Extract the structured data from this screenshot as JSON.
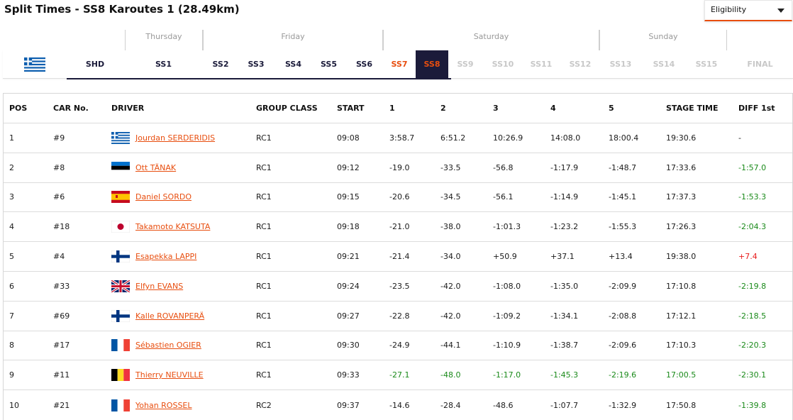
{
  "page": {
    "title": "Split Times - SS8 Karoutes 1 (28.49km)"
  },
  "eligibility": {
    "label": "Eligibility"
  },
  "days": [
    "Thursday",
    "Friday",
    "Saturday",
    "Sunday"
  ],
  "stages": [
    {
      "label": "SHD",
      "state": "done"
    },
    {
      "label": "SS1",
      "state": "done"
    },
    {
      "label": "SS2",
      "state": "done"
    },
    {
      "label": "SS3",
      "state": "done"
    },
    {
      "label": "SS4",
      "state": "done"
    },
    {
      "label": "SS5",
      "state": "done"
    },
    {
      "label": "SS6",
      "state": "done"
    },
    {
      "label": "SS7",
      "state": "live"
    },
    {
      "label": "SS8",
      "state": "active"
    },
    {
      "label": "SS9",
      "state": "future"
    },
    {
      "label": "SS10",
      "state": "future"
    },
    {
      "label": "SS11",
      "state": "future"
    },
    {
      "label": "SS12",
      "state": "future"
    },
    {
      "label": "SS13",
      "state": "future"
    },
    {
      "label": "SS14",
      "state": "future"
    },
    {
      "label": "SS15",
      "state": "future"
    },
    {
      "label": "FINAL",
      "state": "future"
    }
  ],
  "country_flag": "greece-flag",
  "columns": [
    "POS",
    "CAR No.",
    "DRIVER",
    "GROUP CLASS",
    "START",
    "1",
    "2",
    "3",
    "4",
    "5",
    "STAGE TIME",
    "DIFF 1st"
  ],
  "colors": {
    "accent": "#e84e0f",
    "navy": "#1b1b3a",
    "gain": "#1a8a1a",
    "loss": "#e81b1b"
  },
  "rows": [
    {
      "pos": "1",
      "car": "#9",
      "flag": "GR",
      "driver": "Jourdan SERDERIDIS",
      "class": "RC1",
      "start": "09:08",
      "s1": "3:58.7",
      "s2": "6:51.2",
      "s3": "10:26.9",
      "s4": "14:08.0",
      "s5": "18:00.4",
      "stage": "19:30.6",
      "diff": "-",
      "green": []
    },
    {
      "pos": "2",
      "car": "#8",
      "flag": "EE",
      "driver": "Ott TÄNAK",
      "class": "RC1",
      "start": "09:12",
      "s1": "-19.0",
      "s2": "-33.5",
      "s3": "-56.8",
      "s4": "-1:17.9",
      "s5": "-1:48.7",
      "stage": "17:33.6",
      "diff": "-1:57.0",
      "green": [
        "diff"
      ]
    },
    {
      "pos": "3",
      "car": "#6",
      "flag": "ES",
      "driver": "Daniel SORDO",
      "class": "RC1",
      "start": "09:15",
      "s1": "-20.6",
      "s2": "-34.5",
      "s3": "-56.1",
      "s4": "-1:14.9",
      "s5": "-1:45.1",
      "stage": "17:37.3",
      "diff": "-1:53.3",
      "green": [
        "diff"
      ]
    },
    {
      "pos": "4",
      "car": "#18",
      "flag": "JP",
      "driver": "Takamoto KATSUTA",
      "class": "RC1",
      "start": "09:18",
      "s1": "-21.0",
      "s2": "-38.0",
      "s3": "-1:01.3",
      "s4": "-1:23.2",
      "s5": "-1:55.3",
      "stage": "17:26.3",
      "diff": "-2:04.3",
      "green": [
        "diff"
      ]
    },
    {
      "pos": "5",
      "car": "#4",
      "flag": "FI",
      "driver": "Esapekka LAPPI",
      "class": "RC1",
      "start": "09:21",
      "s1": "-21.4",
      "s2": "-34.0",
      "s3": "+50.9",
      "s4": "+37.1",
      "s5": "+13.4",
      "stage": "19:38.0",
      "diff": "+7.4",
      "green": [],
      "red": [
        "diff"
      ]
    },
    {
      "pos": "6",
      "car": "#33",
      "flag": "GB",
      "driver": "Elfyn EVANS",
      "class": "RC1",
      "start": "09:24",
      "s1": "-23.5",
      "s2": "-42.0",
      "s3": "-1:08.0",
      "s4": "-1:35.0",
      "s5": "-2:09.9",
      "stage": "17:10.8",
      "diff": "-2:19.8",
      "green": [
        "diff"
      ]
    },
    {
      "pos": "7",
      "car": "#69",
      "flag": "FI",
      "driver": "Kalle ROVANPERÄ",
      "class": "RC1",
      "start": "09:27",
      "s1": "-22.8",
      "s2": "-42.0",
      "s3": "-1:09.2",
      "s4": "-1:34.1",
      "s5": "-2:08.8",
      "stage": "17:12.1",
      "diff": "-2:18.5",
      "green": [
        "diff"
      ]
    },
    {
      "pos": "8",
      "car": "#17",
      "flag": "FR",
      "driver": "Sébastien OGIER",
      "class": "RC1",
      "start": "09:30",
      "s1": "-24.9",
      "s2": "-44.1",
      "s3": "-1:10.9",
      "s4": "-1:38.7",
      "s5": "-2:09.6",
      "stage": "17:10.3",
      "diff": "-2:20.3",
      "green": [
        "diff"
      ]
    },
    {
      "pos": "9",
      "car": "#11",
      "flag": "BE",
      "driver": "Thierry NEUVILLE",
      "class": "RC1",
      "start": "09:33",
      "s1": "-27.1",
      "s2": "-48.0",
      "s3": "-1:17.0",
      "s4": "-1:45.3",
      "s5": "-2:19.6",
      "stage": "17:00.5",
      "diff": "-2:30.1",
      "green": [
        "s1",
        "s2",
        "s3",
        "s4",
        "s5",
        "stage",
        "diff"
      ]
    },
    {
      "pos": "10",
      "car": "#21",
      "flag": "FR",
      "driver": "Yohan ROSSEL",
      "class": "RC2",
      "start": "09:37",
      "s1": "-14.6",
      "s2": "-28.4",
      "s3": "-48.6",
      "s4": "-1:07.7",
      "s5": "-1:32.9",
      "stage": "17:50.8",
      "diff": "-1:39.8",
      "green": [
        "diff"
      ]
    }
  ]
}
